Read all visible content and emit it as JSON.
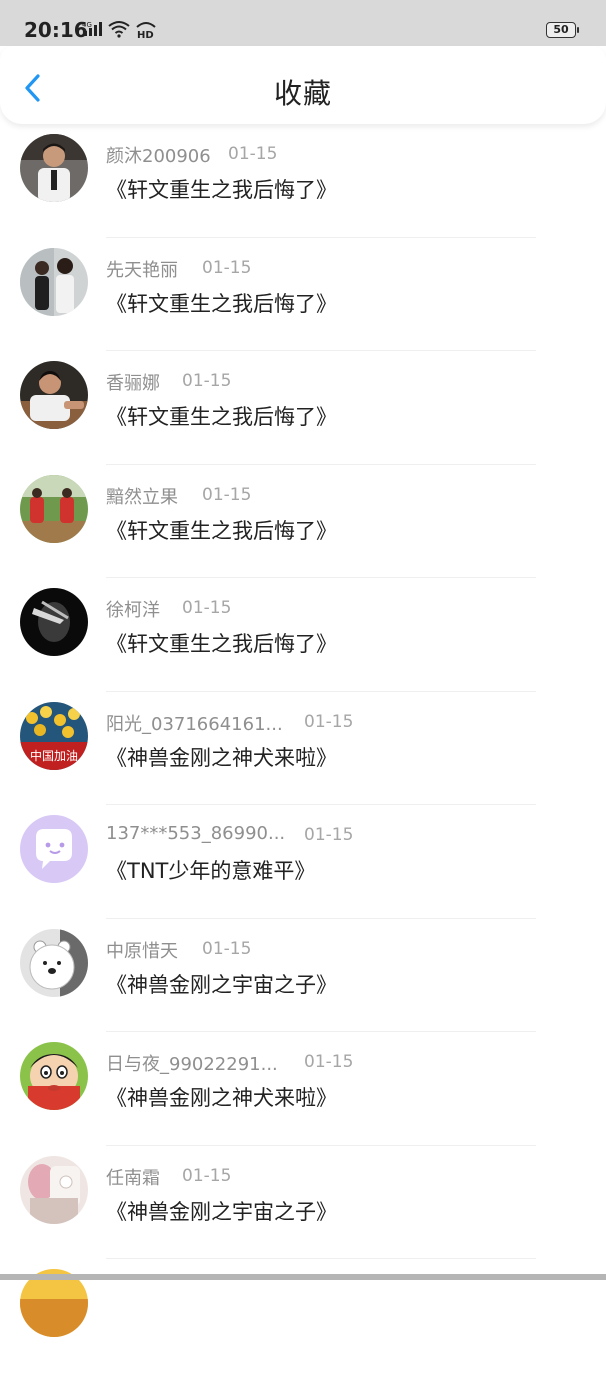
{
  "status_bar": {
    "time": "20:16",
    "network": "4G",
    "hd": "HD",
    "battery": "50"
  },
  "header": {
    "title": "收藏"
  },
  "items": [
    {
      "name": "颜沐200906",
      "date": "01-15",
      "title": "《轩文重生之我后悔了》"
    },
    {
      "name": "先天艳丽",
      "date": "01-15",
      "title": "《轩文重生之我后悔了》"
    },
    {
      "name": "香骊娜",
      "date": "01-15",
      "title": "《轩文重生之我后悔了》"
    },
    {
      "name": "黯然立果",
      "date": "01-15",
      "title": "《轩文重生之我后悔了》"
    },
    {
      "name": "徐柯洋",
      "date": "01-15",
      "title": "《轩文重生之我后悔了》"
    },
    {
      "name": "阳光_0371664161...",
      "date": "01-15",
      "title": "《神兽金刚之神犬来啦》",
      "avatar_text": "中国加油"
    },
    {
      "name": "137***553_86990...",
      "date": "01-15",
      "title": "《TNT少年的意难平》"
    },
    {
      "name": "中原惜天",
      "date": "01-15",
      "title": "《神兽金刚之宇宙之子》"
    },
    {
      "name": "日与夜_99022291...",
      "date": "01-15",
      "title": "《神兽金刚之神犬来啦》"
    },
    {
      "name": "任南霜",
      "date": "01-15",
      "title": "《神兽金刚之宇宙之子》"
    }
  ],
  "colors": {
    "accent": "#2196f3",
    "name": "#8f8f8f",
    "date": "#a6a6a6",
    "title": "#222222"
  }
}
